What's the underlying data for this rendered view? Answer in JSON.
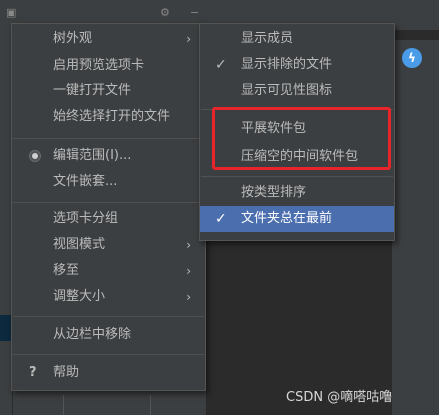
{
  "main_menu": {
    "items": [
      {
        "label": "树外观",
        "submenu": true
      },
      {
        "label": "启用预览选项卡"
      },
      {
        "label": "一键打开文件"
      },
      {
        "label": "始终选择打开的文件"
      },
      {
        "label": "编辑范围(I)...",
        "radio": true
      },
      {
        "label": "文件嵌套..."
      },
      {
        "label": "选项卡分组"
      },
      {
        "label": "视图模式",
        "submenu": true
      },
      {
        "label": "移至",
        "submenu": true
      },
      {
        "label": "调整大小",
        "submenu": true
      },
      {
        "label": "从边栏中移除"
      },
      {
        "label": "帮助",
        "icon": "question-icon"
      }
    ],
    "arrow_glyph": "›",
    "help_glyph": "?"
  },
  "sub_menu": {
    "items": [
      {
        "label": "显示成员"
      },
      {
        "label": "显示排除的文件",
        "checked": true
      },
      {
        "label": "显示可见性图标"
      },
      {
        "label": "平展软件包"
      },
      {
        "label": "压缩空的中间软件包"
      },
      {
        "label": "按类型排序"
      },
      {
        "label": "文件夹总在最前",
        "checked": true
      }
    ],
    "check_glyph": "✓"
  },
  "colors": {
    "menu_bg": "#3c3f41",
    "selection": "#4b6eaf",
    "highlight_box": "#e8252a"
  },
  "watermark": "CSDN @嘀嗒咕噜"
}
